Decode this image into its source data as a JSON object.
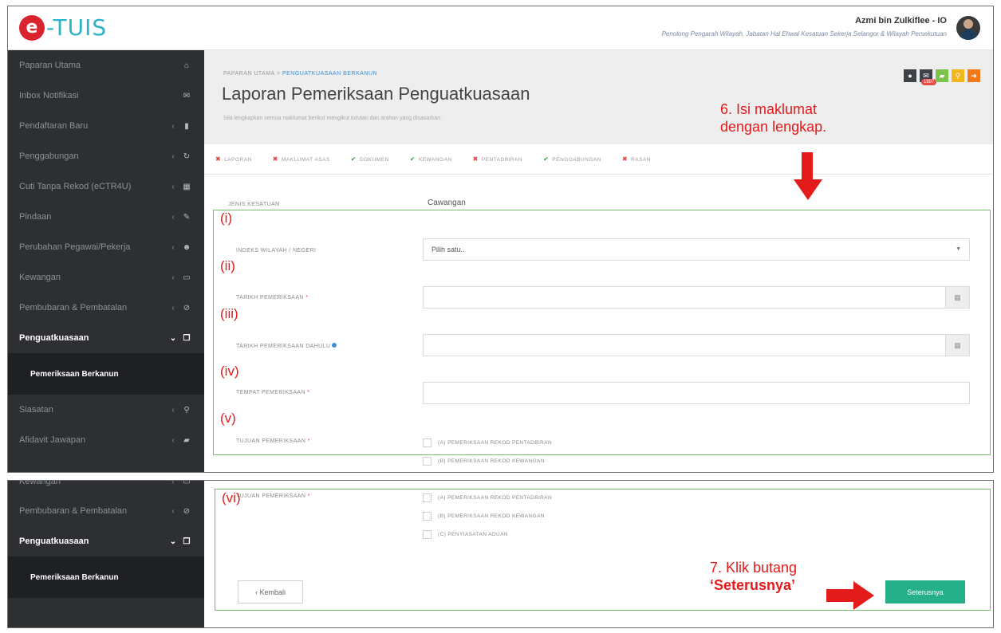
{
  "header": {
    "logo_letter": "e",
    "logo_text": "-TUIS",
    "user_name": "Azmi bin Zulkiflee - IO",
    "user_role": "Penolong Pengarah Wilayah, Jabatan Hal Ehwal Kesatuan Sekerja Selangor & Wilayah Persekutuan"
  },
  "sidebar": {
    "items": [
      {
        "label": "Paparan Utama",
        "chevron": "",
        "icon": "home-icon",
        "glyph": "⌂"
      },
      {
        "label": "Inbox Notifikasi",
        "chevron": "",
        "icon": "envelope-icon",
        "glyph": "✉"
      },
      {
        "label": "Pendaftaran Baru",
        "chevron": "‹",
        "icon": "file-icon",
        "glyph": "▮"
      },
      {
        "label": "Penggabungan",
        "chevron": "‹",
        "icon": "refresh-icon",
        "glyph": "↻"
      },
      {
        "label": "Cuti Tanpa Rekod (eCTR4U)",
        "chevron": "‹",
        "icon": "calendar-icon",
        "glyph": "▦"
      },
      {
        "label": "Pindaan",
        "chevron": "‹",
        "icon": "edit-icon",
        "glyph": "✎"
      },
      {
        "label": "Perubahan Pegawai/Pekerja",
        "chevron": "‹",
        "icon": "users-icon",
        "glyph": "☻"
      },
      {
        "label": "Kewangan",
        "chevron": "‹",
        "icon": "money-icon",
        "glyph": "▭"
      },
      {
        "label": "Pembubaran & Pembatalan",
        "chevron": "‹",
        "icon": "ban-icon",
        "glyph": "⊘"
      },
      {
        "label": "Penguatkuasaan",
        "chevron": "⌄",
        "icon": "copy-icon",
        "glyph": "❐"
      }
    ],
    "sub_item": "Pemeriksaan Berkanun",
    "after_items": [
      {
        "label": "Siasatan",
        "chevron": "‹",
        "icon": "search-icon",
        "glyph": "⚲"
      },
      {
        "label": "Afidavit Jawapan",
        "chevron": "‹",
        "icon": "folder-icon",
        "glyph": "▰"
      }
    ]
  },
  "breadcrumb": {
    "home": "PAPARAN UTAMA",
    "sep": ">",
    "current": "PENGUATKUASAAN BERKANUN"
  },
  "page": {
    "title": "Laporan Pemeriksaan Penguatkuasaan",
    "subtitle": "Sila lengkapkan semua maklumat berikut mengikut turutan dan arahan yang disasarkan."
  },
  "toolbar": {
    "badge": "1897"
  },
  "steps": [
    {
      "label": "LAPORAN",
      "status": "x"
    },
    {
      "label": "MAKLUMAT ASAS",
      "status": "x"
    },
    {
      "label": "DOKUMEN",
      "status": "ok"
    },
    {
      "label": "KEWANGAN",
      "status": "ok"
    },
    {
      "label": "PENTADBIRAN",
      "status": "x"
    },
    {
      "label": "PENGGABUNGAN",
      "status": "ok"
    },
    {
      "label": "RASAN",
      "status": "x"
    }
  ],
  "form": {
    "jenis_label": "JENIS KESATUAN",
    "jenis_value": "Cawangan",
    "indeks_label": "INDEKS WILAYAH / NEGERI",
    "indeks_value": "Pilih satu..",
    "tarikh_label": "TARIKH PEMERIKSAAN",
    "tarikh_dahulu_label": "TARIKH PEMERIKSAAN DAHULU",
    "tempat_label": "TEMPAT PEMERIKSAAN",
    "tujuan_label": "TUJUAN PEMERIKSAAN",
    "req_mark": "*",
    "options": [
      "(A) PEMERIKSAAN REKOD PENTADBIRAN",
      "(B) PEMERIKSAAN REKOD KEWANGAN",
      "(C) PENYIASATAN ADUAN"
    ]
  },
  "annotations": {
    "step6_line1": "6. Isi maklumat",
    "step6_line2": "dengan lengkap.",
    "step7_line1": "7. Klik butang",
    "step7_line2": "‘Seterusnya’",
    "labels": [
      "(i)",
      "(ii)",
      "(iii)",
      "(iv)",
      "(v)",
      "(vi)"
    ],
    "color": "#e31b1b",
    "box_color": "#78c06e"
  },
  "buttons": {
    "back": "‹ Kembali",
    "next": "Seterusnya"
  },
  "colors": {
    "sidebar_bg": "#2d2f33",
    "accent_green": "#26b08a",
    "header_bg": "#eeeeee"
  }
}
